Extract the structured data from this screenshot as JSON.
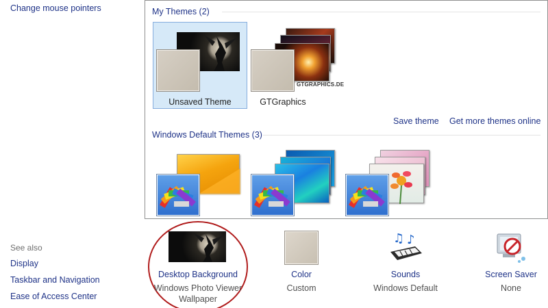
{
  "nav": {
    "top_link": "Change mouse pointers",
    "see_also": "See also",
    "links": [
      "Display",
      "Taskbar and Navigation",
      "Ease of Access Center"
    ]
  },
  "my_themes": {
    "header": "My Themes (2)",
    "items": [
      {
        "name": "Unsaved Theme",
        "selected": true
      },
      {
        "name": "GTGraphics",
        "selected": false,
        "logo_text": "GTGRAPHICS.DE"
      }
    ],
    "save_link": "Save theme",
    "more_link": "Get more themes online"
  },
  "default_themes": {
    "header": "Windows Default Themes (3)",
    "count": 3
  },
  "bottom": {
    "background": {
      "title": "Desktop Background",
      "sub1": "Windows Photo Viewer",
      "sub2": "Wallpaper"
    },
    "color": {
      "title": "Color",
      "sub": "Custom"
    },
    "sounds": {
      "title": "Sounds",
      "sub": "Windows Default"
    },
    "screensaver": {
      "title": "Screen Saver",
      "sub": "None"
    }
  },
  "colors": {
    "link": "#1e3287",
    "selection": "#d6e9f8",
    "highlight_circle": "#b01b1b"
  }
}
